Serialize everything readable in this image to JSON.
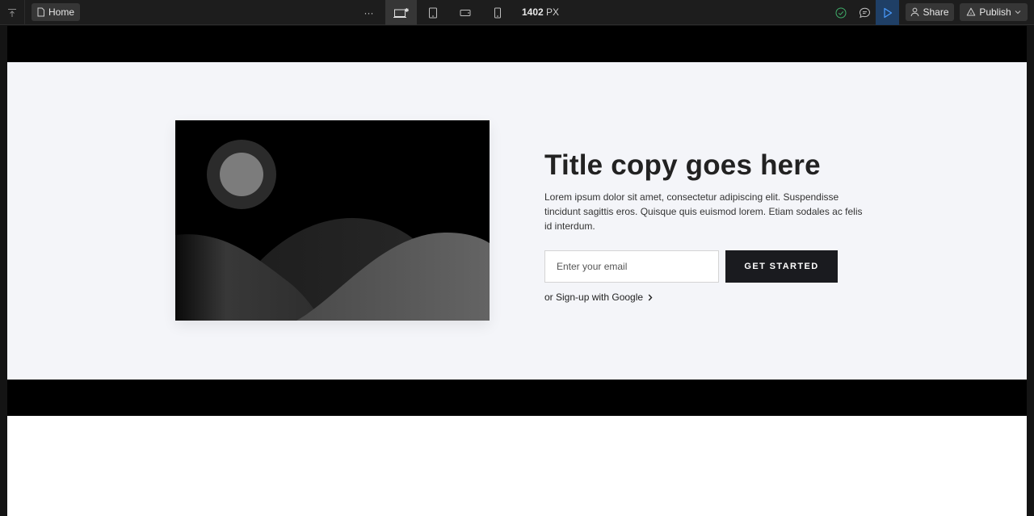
{
  "toolbar": {
    "page_name": "Home",
    "more_label": "···",
    "canvas_width_value": "1402",
    "canvas_width_unit": "PX",
    "share_label": "Share",
    "publish_label": "Publish",
    "colors": {
      "bar": "#1d1d1d",
      "active": "#363636",
      "play_bg": "#1f3f66",
      "check": "#3fae6a"
    },
    "icons": [
      "upload-icon",
      "page-icon",
      "more-icon",
      "desktop-breakpoint-icon",
      "tablet-icon",
      "mobile-landscape-icon",
      "mobile-portrait-icon",
      "check-circle-icon",
      "comment-icon",
      "play-icon",
      "user-icon",
      "rocket-icon",
      "chevron-down-icon"
    ]
  },
  "hero": {
    "title": "Title copy goes here",
    "body": "Lorem ipsum dolor sit amet, consectetur adipiscing elit. Suspendisse tincidunt sagittis eros. Quisque quis euismod lorem. Etiam sodales ac felis id interdum.",
    "email_placeholder": "Enter your email",
    "cta_label": "GET STARTED",
    "google_link": "or Sign-up with Google",
    "colors": {
      "background": "#f4f5f9",
      "cta": "#1a1b1f"
    }
  }
}
